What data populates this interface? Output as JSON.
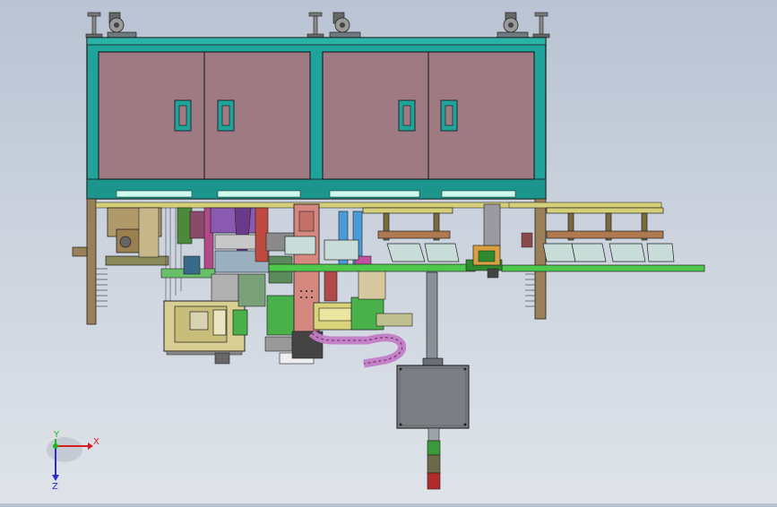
{
  "viewport": {
    "background_top": "#b9c3d3",
    "background_bottom": "#dfe3e9"
  },
  "model": {
    "frame_color": "#1fa39a",
    "panel_color": "#a07a82",
    "handle_color": "#1fa39a",
    "rail_color": "#4dc84a",
    "control_box_color": "#7b7e84",
    "drag_chain_color": "#c47cc6",
    "signal_tower_colors": [
      "#3a9a3a",
      "#6a6a4a",
      "#b22a2a"
    ]
  },
  "triad": {
    "x_label": "X",
    "y_label": "Y",
    "z_label": "Z",
    "x_color": "#d62020",
    "y_color": "#1db81d",
    "z_color": "#2a2ad0"
  }
}
